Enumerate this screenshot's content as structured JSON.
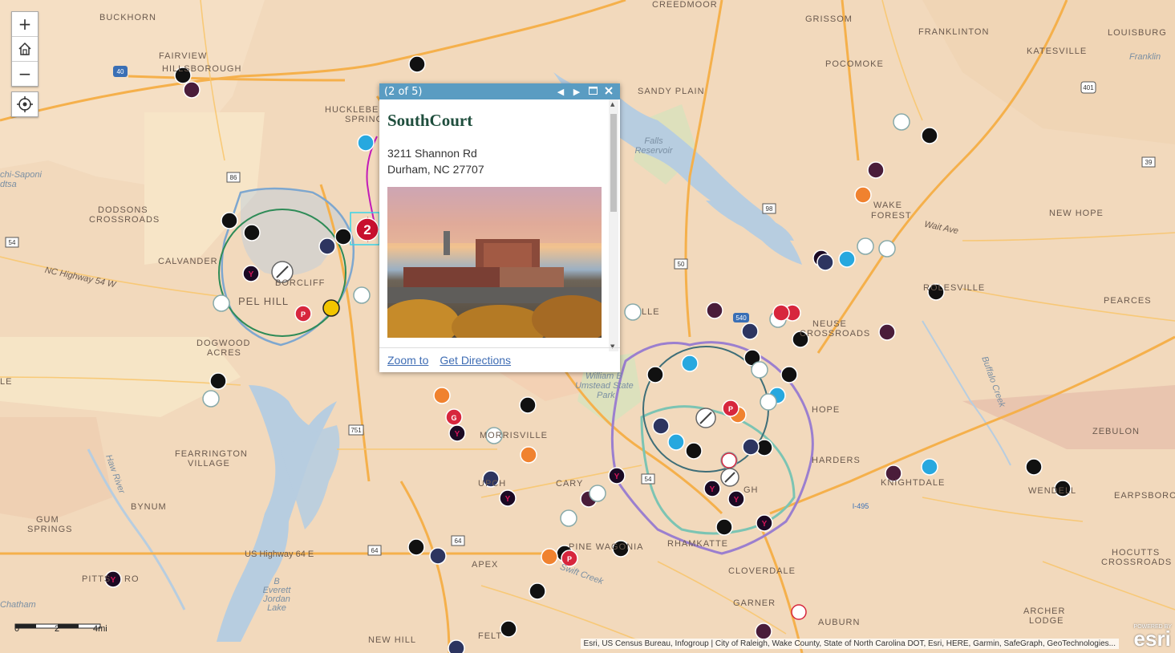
{
  "colors": {
    "land": "#f2d9bc",
    "forest_light": "#f7e6c8",
    "water": "#b7cde0",
    "road": "#f8c66f",
    "highway": "#f5b04b",
    "popup_header": "#5a9cc2",
    "popup_title": "#1f4e3d",
    "link": "#3f6db4"
  },
  "controls": {
    "zoom_in": "+",
    "home_icon": "home-icon",
    "zoom_out": "−",
    "locate_icon": "locate-icon"
  },
  "places": [
    {
      "label": "BUCKHORN"
    },
    {
      "label": "CREEDMOOR"
    },
    {
      "label": "GRISSOM"
    },
    {
      "label": "FRANKLINTON"
    },
    {
      "label": "LOUISBURG"
    },
    {
      "label": "KATESVILLE"
    },
    {
      "label": "Franklin"
    },
    {
      "label": "FAIRVIEW"
    },
    {
      "label": "HILLSBOROUGH"
    },
    {
      "label": "POCOMOKE"
    },
    {
      "label": "SANDY PLAIN"
    },
    {
      "label": "HUCKLEBE"
    },
    {
      "label": "SPRING"
    },
    {
      "label": "Falls Reservoir"
    },
    {
      "label": "chi-Saponi"
    },
    {
      "label": "dtsa"
    },
    {
      "label": "DODSONS"
    },
    {
      "label": "CROSSROADS"
    },
    {
      "label": "WAKE"
    },
    {
      "label": "FOREST"
    },
    {
      "label": "NEW HOPE"
    },
    {
      "label": "Wait Ave"
    },
    {
      "label": "CALVANDER"
    },
    {
      "label": "NC Highway 54 W"
    },
    {
      "label": "BORCLIFF"
    },
    {
      "label": "PEL HILL"
    },
    {
      "label": "ROLESVILLE"
    },
    {
      "label": "PEARCES"
    },
    {
      "label": "DOGWOOD"
    },
    {
      "label": "ACRES"
    },
    {
      "label": "NEUSE"
    },
    {
      "label": "CROSSROADS"
    },
    {
      "label": "LLE"
    },
    {
      "label": "William B"
    },
    {
      "label": "Umstead State"
    },
    {
      "label": "Park"
    },
    {
      "label": "LE"
    },
    {
      "label": "MORRISVILLE"
    },
    {
      "label": "HOPE"
    },
    {
      "label": "ZEBULON"
    },
    {
      "label": "FEARRINGTON"
    },
    {
      "label": "VILLAGE"
    },
    {
      "label": "Haw River"
    },
    {
      "label": "UPCH"
    },
    {
      "label": "CARY"
    },
    {
      "label": "GH"
    },
    {
      "label": "WENDELL"
    },
    {
      "label": "KNIGHTDALE"
    },
    {
      "label": "EARPSBORO"
    },
    {
      "label": "BYNUM"
    },
    {
      "label": "GUM"
    },
    {
      "label": "SPRINGS"
    },
    {
      "label": "US Highway 64 E"
    },
    {
      "label": "APEX"
    },
    {
      "label": "RHAMKATTE"
    },
    {
      "label": "PINE WAGONIA"
    },
    {
      "label": "HOCUTTS"
    },
    {
      "label": "CROSSROADS"
    },
    {
      "label": "PITTS"
    },
    {
      "label": "RO"
    },
    {
      "label": "B Everett Jordan Lake"
    },
    {
      "label": "CLOVERDALE"
    },
    {
      "label": "Swift Creek"
    },
    {
      "label": "GARNER"
    },
    {
      "label": "ARCHER"
    },
    {
      "label": "LODGE"
    },
    {
      "label": "Chatham"
    },
    {
      "label": "NEW HILL"
    },
    {
      "label": "FELT"
    },
    {
      "label": "AUBURN"
    },
    {
      "label": "Buffalo Creek"
    },
    {
      "label": "HARDERS"
    }
  ],
  "road_shields": [
    "40",
    "86",
    "54",
    "751",
    "401",
    "39",
    "98",
    "50",
    "540",
    "54",
    "64",
    "64",
    "I-495"
  ],
  "popup": {
    "counter": "(2 of 5)",
    "title": "SouthCourt",
    "address_line1": "3211 Shannon Rd",
    "address_line2": "Durham, NC 27707",
    "image_alt": "aerial-photo-southcourt",
    "zoom_to": "Zoom to",
    "get_directions": "Get Directions"
  },
  "cluster_label": "2",
  "poi_types": [
    "crossfit",
    "ymca",
    "f45",
    "planet-fitness",
    "orangetheory",
    "burn-boot-camp",
    "orange-cross",
    "red-p"
  ],
  "scale": {
    "zero": "0",
    "mid": "2",
    "end": "4mi"
  },
  "attribution": "Esri, US Census Bureau, Infogroup | City of Raleigh, Wake County, State of North Carolina DOT, Esri, HERE, Garmin, SafeGraph, GeoTechnologies...",
  "esri": {
    "powered": "POWERED BY",
    "logo": "esri"
  }
}
